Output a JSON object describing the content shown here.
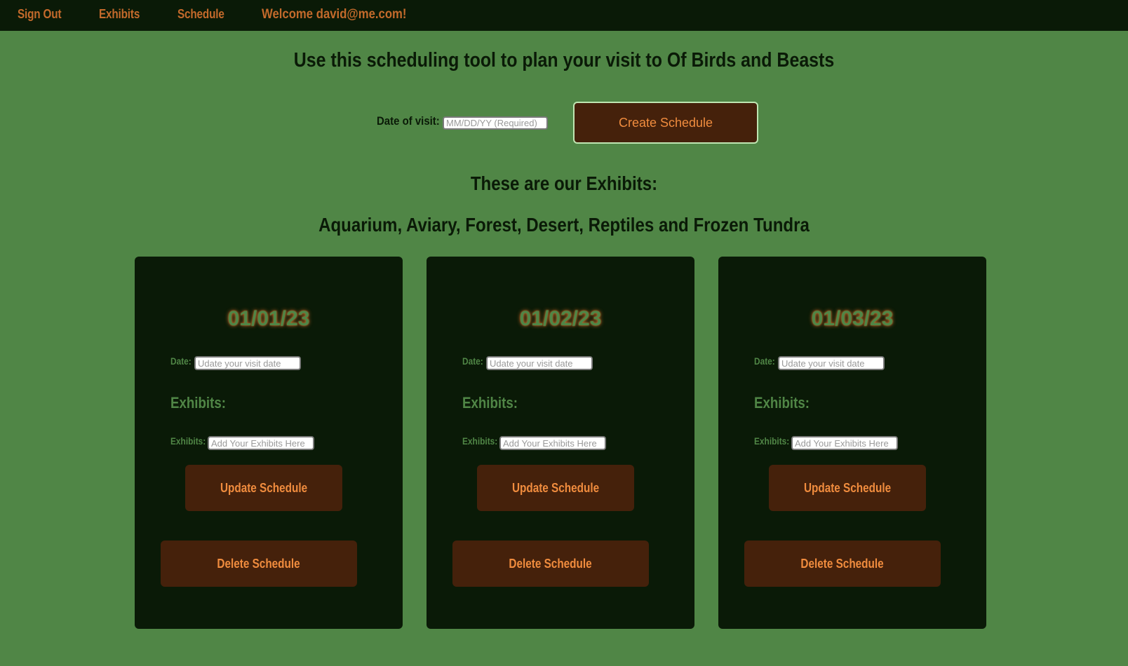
{
  "nav": {
    "sign_out": "Sign Out",
    "exhibits": "Exhibits",
    "schedule": "Schedule",
    "welcome": "Welcome david@me.com!"
  },
  "page_title": "Use this scheduling tool to plan your visit to Of Birds and Beasts",
  "create_form": {
    "date_label": "Date of visit:",
    "date_placeholder": "MM/DD/YY (Required)",
    "date_value": "",
    "create_button": "Create Schedule"
  },
  "exhibits_intro": {
    "heading": "These are our Exhibits:",
    "list": "Aquarium, Aviary, Forest, Desert, Reptiles and Frozen Tundra"
  },
  "schedules": [
    {
      "date": "01/01/23",
      "date_label": "Date:",
      "date_placeholder": "Udate your visit date",
      "exhibits_heading": "Exhibits:",
      "exhibits_label": "Exhibits:",
      "exhibits_placeholder": "Add Your Exhibits Here",
      "update_button": "Update Schedule",
      "delete_button": "Delete Schedule"
    },
    {
      "date": "01/02/23",
      "date_label": "Date:",
      "date_placeholder": "Udate your visit date",
      "exhibits_heading": "Exhibits:",
      "exhibits_label": "Exhibits:",
      "exhibits_placeholder": "Add Your Exhibits Here",
      "update_button": "Update Schedule",
      "delete_button": "Delete Schedule"
    },
    {
      "date": "01/03/23",
      "date_label": "Date:",
      "date_placeholder": "Udate your visit date",
      "exhibits_heading": "Exhibits:",
      "exhibits_label": "Exhibits:",
      "exhibits_placeholder": "Add Your Exhibits Here",
      "update_button": "Update Schedule",
      "delete_button": "Delete Schedule"
    }
  ],
  "colors": {
    "background": "#508646",
    "dark": "#0a1a07",
    "brown_button": "#45210b",
    "orange_text": "#f08c3e",
    "nav_text": "#c36a2b"
  }
}
